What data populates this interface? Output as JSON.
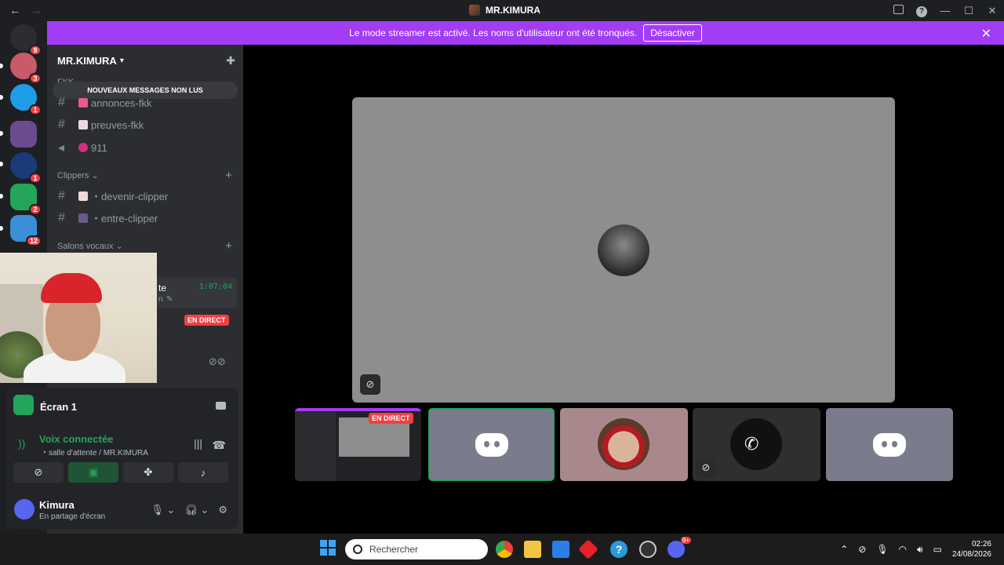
{
  "window": {
    "title": "MR.KIMURA",
    "back": "←",
    "forward": "→",
    "minimize": "—",
    "maximize": "☐",
    "close": "✕"
  },
  "banner": {
    "text": "Le mode streamer est activé. Les noms d'utilisateur ont été tronqués.",
    "button": "Désactiver",
    "close": "✕"
  },
  "servers": [
    {
      "badge": "9",
      "color": "#5865f2"
    },
    {
      "badge": "3",
      "color": "#c85a6a"
    },
    {
      "badge": "1",
      "color": "#1e9ee8"
    },
    {
      "badge": "",
      "color": "#6a4c8e"
    },
    {
      "badge": "1",
      "color": "#1a3a7a"
    },
    {
      "badge": "2",
      "color": "#23a55a"
    },
    {
      "badge": "12",
      "color": "#3a8fd8"
    }
  ],
  "sidebar": {
    "server_name": "MR.KIMURA",
    "new_messages": "NOUVEAUX MESSAGES NON LUS",
    "category_top": "FKK",
    "channels_top": [
      {
        "name": "annonces-fkk",
        "type": "text"
      },
      {
        "name": "preuves-fkk",
        "type": "text"
      },
      {
        "name": "911",
        "type": "announce"
      }
    ],
    "category_clippers": "Clippers",
    "channels_clippers": [
      {
        "name": "・devenir-clipper"
      },
      {
        "name": "・entre-clipper"
      }
    ],
    "category_voice": "Salons vocaux",
    "voice_channel": {
      "name": "te",
      "timer": "1:07:04",
      "sub": "n"
    },
    "live_badge": "EN DIRECT"
  },
  "panel": {
    "screen_name": "Écran 1",
    "voice_status": "Voix connectée",
    "voice_room": "・salle d'attente / MR.KIMURA",
    "user_name": "Kimura",
    "user_status": "En partage d'écran"
  },
  "stage": {
    "live_badge": "EN DIRECT"
  },
  "taskbar": {
    "search_placeholder": "Rechercher",
    "time": "02:26",
    "date": "24/08/2026",
    "discord_badge": "9+"
  },
  "colors": {
    "accent_purple": "#a33cf5",
    "green": "#23a55a",
    "red": "#f23f43",
    "blurple": "#5865f2"
  }
}
